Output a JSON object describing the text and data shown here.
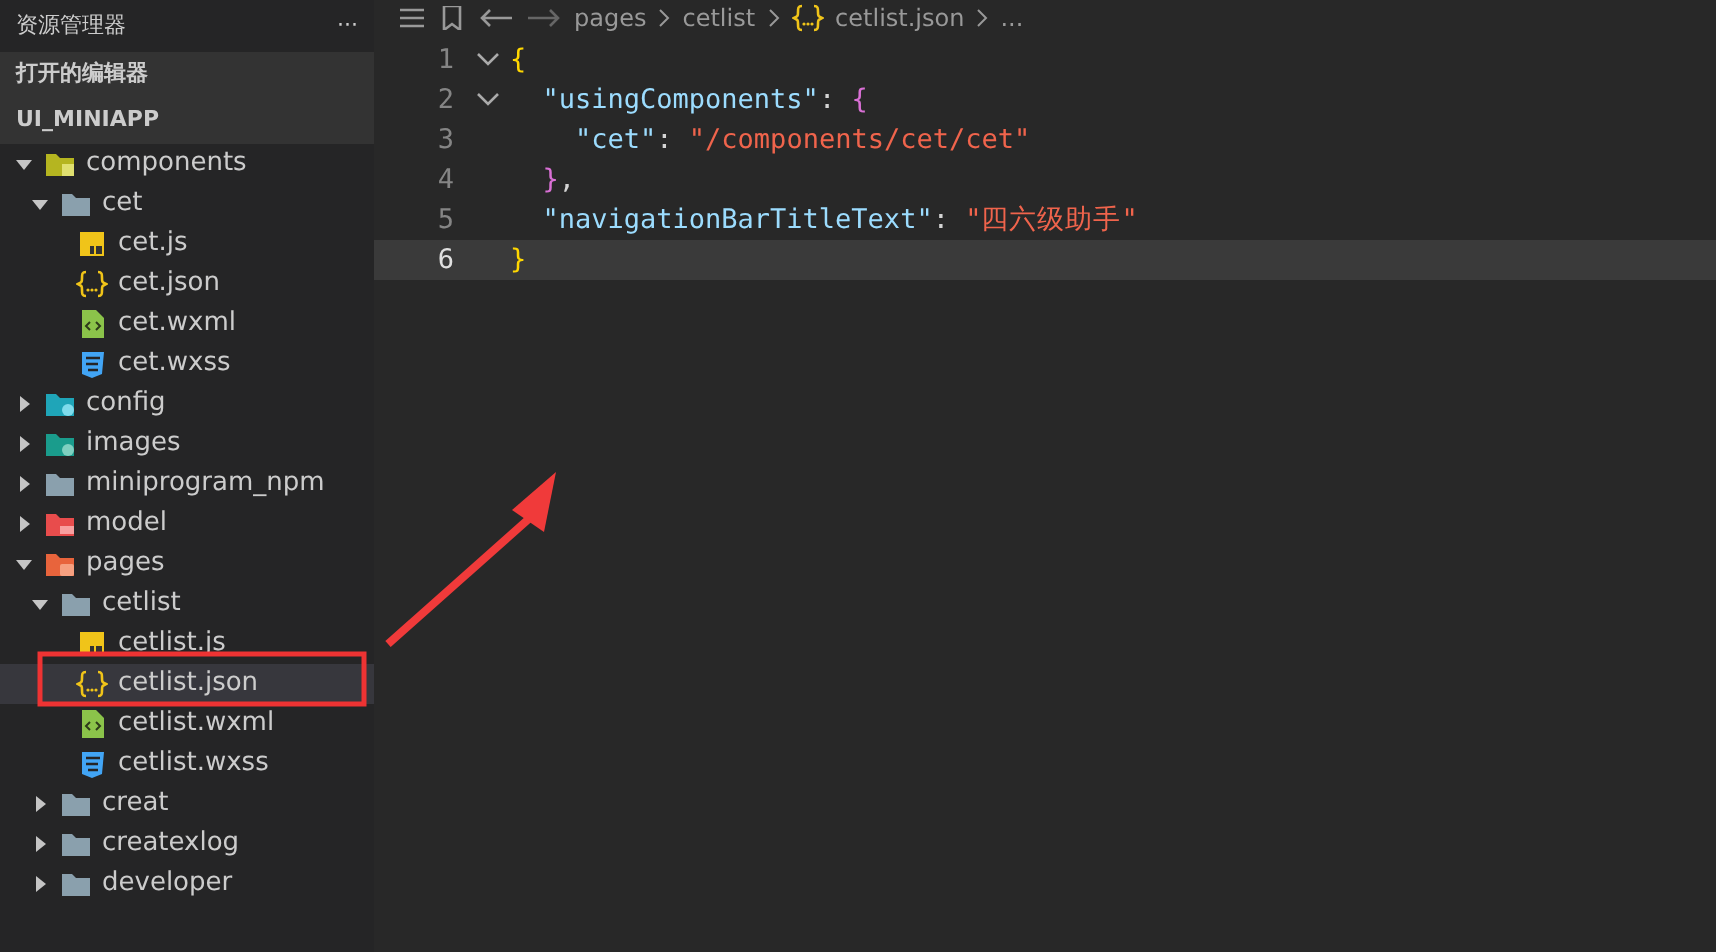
{
  "sidebar": {
    "title": "资源管理器",
    "more": "···",
    "sections": [
      {
        "label": "打开的编辑器"
      },
      {
        "label": "UI_MINIAPP"
      }
    ],
    "tree": [
      {
        "label": "components",
        "kind": "components-folder",
        "expanded": true,
        "selected": false,
        "children": [
          {
            "label": "cet",
            "kind": "folder",
            "expanded": true,
            "selected": false,
            "children": [
              {
                "label": "cet.js",
                "kind": "js",
                "selected": false
              },
              {
                "label": "cet.json",
                "kind": "json",
                "selected": false
              },
              {
                "label": "cet.wxml",
                "kind": "wxml",
                "selected": false
              },
              {
                "label": "cet.wxss",
                "kind": "wxss",
                "selected": false
              }
            ]
          }
        ]
      },
      {
        "label": "config",
        "kind": "config-folder",
        "expanded": false,
        "selected": false
      },
      {
        "label": "images",
        "kind": "images-folder",
        "expanded": false,
        "selected": false
      },
      {
        "label": "miniprogram_npm",
        "kind": "folder",
        "expanded": false,
        "selected": false
      },
      {
        "label": "model",
        "kind": "model-folder",
        "expanded": false,
        "selected": false
      },
      {
        "label": "pages",
        "kind": "pages-folder",
        "expanded": true,
        "selected": false,
        "children": [
          {
            "label": "cetlist",
            "kind": "folder",
            "expanded": true,
            "selected": false,
            "children": [
              {
                "label": "cetlist.js",
                "kind": "js",
                "selected": false
              },
              {
                "label": "cetlist.json",
                "kind": "json",
                "selected": true
              },
              {
                "label": "cetlist.wxml",
                "kind": "wxml",
                "selected": false
              },
              {
                "label": "cetlist.wxss",
                "kind": "wxss",
                "selected": false
              }
            ]
          },
          {
            "label": "creat",
            "kind": "folder",
            "expanded": false,
            "selected": false
          },
          {
            "label": "createxlog",
            "kind": "folder",
            "expanded": false,
            "selected": false
          },
          {
            "label": "developer",
            "kind": "folder",
            "expanded": false,
            "selected": false
          }
        ]
      }
    ]
  },
  "breadcrumb": [
    {
      "label": "pages",
      "kind": "folder"
    },
    {
      "label": "cetlist",
      "kind": "folder"
    },
    {
      "label": "cetlist.json",
      "kind": "json"
    },
    {
      "label": "...",
      "kind": "more"
    }
  ],
  "editor": {
    "lines": [
      {
        "number": "1",
        "foldable": true,
        "current": false,
        "tokens": [
          {
            "kind": "bracket1",
            "text": "{"
          }
        ]
      },
      {
        "number": "2",
        "foldable": true,
        "current": false,
        "tokens": [
          {
            "kind": "key",
            "text": "  \"usingComponents\""
          },
          {
            "kind": "punct",
            "text": ": "
          },
          {
            "kind": "bracket2",
            "text": "{"
          }
        ]
      },
      {
        "number": "3",
        "foldable": false,
        "current": false,
        "tokens": [
          {
            "kind": "key",
            "text": "    \"cet\""
          },
          {
            "kind": "punct",
            "text": ": "
          },
          {
            "kind": "string",
            "text": "\"/components/cet/cet\""
          }
        ]
      },
      {
        "number": "4",
        "foldable": false,
        "current": false,
        "tokens": [
          {
            "kind": "bracket2",
            "text": "  }"
          },
          {
            "kind": "punct",
            "text": ","
          }
        ]
      },
      {
        "number": "5",
        "foldable": false,
        "current": false,
        "tokens": [
          {
            "kind": "key",
            "text": "  \"navigationBarTitleText\""
          },
          {
            "kind": "punct",
            "text": ": "
          },
          {
            "kind": "string",
            "text": "\"四六级助手\""
          }
        ]
      },
      {
        "number": "6",
        "foldable": false,
        "current": true,
        "tokens": [
          {
            "kind": "bracket1",
            "text": "}"
          }
        ]
      }
    ]
  }
}
